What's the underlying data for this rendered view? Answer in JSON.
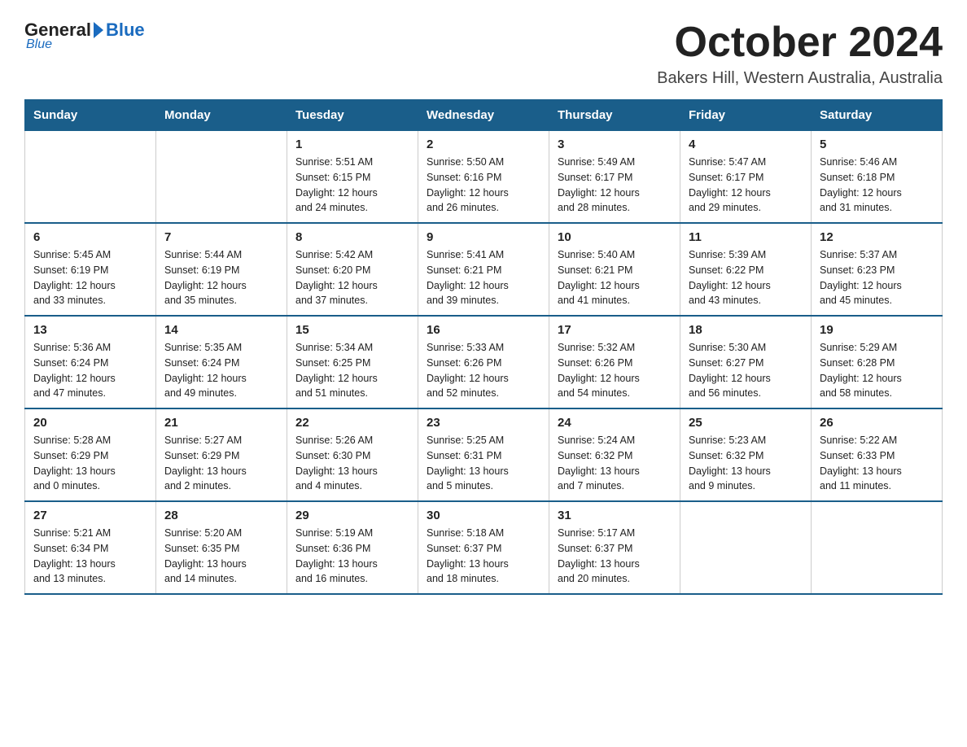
{
  "logo": {
    "text_general": "General",
    "text_blue": "Blue",
    "underline": "Blue"
  },
  "header": {
    "month": "October 2024",
    "location": "Bakers Hill, Western Australia, Australia"
  },
  "days_of_week": [
    "Sunday",
    "Monday",
    "Tuesday",
    "Wednesday",
    "Thursday",
    "Friday",
    "Saturday"
  ],
  "weeks": [
    [
      {
        "day": "",
        "info": ""
      },
      {
        "day": "",
        "info": ""
      },
      {
        "day": "1",
        "info": "Sunrise: 5:51 AM\nSunset: 6:15 PM\nDaylight: 12 hours\nand 24 minutes."
      },
      {
        "day": "2",
        "info": "Sunrise: 5:50 AM\nSunset: 6:16 PM\nDaylight: 12 hours\nand 26 minutes."
      },
      {
        "day": "3",
        "info": "Sunrise: 5:49 AM\nSunset: 6:17 PM\nDaylight: 12 hours\nand 28 minutes."
      },
      {
        "day": "4",
        "info": "Sunrise: 5:47 AM\nSunset: 6:17 PM\nDaylight: 12 hours\nand 29 minutes."
      },
      {
        "day": "5",
        "info": "Sunrise: 5:46 AM\nSunset: 6:18 PM\nDaylight: 12 hours\nand 31 minutes."
      }
    ],
    [
      {
        "day": "6",
        "info": "Sunrise: 5:45 AM\nSunset: 6:19 PM\nDaylight: 12 hours\nand 33 minutes."
      },
      {
        "day": "7",
        "info": "Sunrise: 5:44 AM\nSunset: 6:19 PM\nDaylight: 12 hours\nand 35 minutes."
      },
      {
        "day": "8",
        "info": "Sunrise: 5:42 AM\nSunset: 6:20 PM\nDaylight: 12 hours\nand 37 minutes."
      },
      {
        "day": "9",
        "info": "Sunrise: 5:41 AM\nSunset: 6:21 PM\nDaylight: 12 hours\nand 39 minutes."
      },
      {
        "day": "10",
        "info": "Sunrise: 5:40 AM\nSunset: 6:21 PM\nDaylight: 12 hours\nand 41 minutes."
      },
      {
        "day": "11",
        "info": "Sunrise: 5:39 AM\nSunset: 6:22 PM\nDaylight: 12 hours\nand 43 minutes."
      },
      {
        "day": "12",
        "info": "Sunrise: 5:37 AM\nSunset: 6:23 PM\nDaylight: 12 hours\nand 45 minutes."
      }
    ],
    [
      {
        "day": "13",
        "info": "Sunrise: 5:36 AM\nSunset: 6:24 PM\nDaylight: 12 hours\nand 47 minutes."
      },
      {
        "day": "14",
        "info": "Sunrise: 5:35 AM\nSunset: 6:24 PM\nDaylight: 12 hours\nand 49 minutes."
      },
      {
        "day": "15",
        "info": "Sunrise: 5:34 AM\nSunset: 6:25 PM\nDaylight: 12 hours\nand 51 minutes."
      },
      {
        "day": "16",
        "info": "Sunrise: 5:33 AM\nSunset: 6:26 PM\nDaylight: 12 hours\nand 52 minutes."
      },
      {
        "day": "17",
        "info": "Sunrise: 5:32 AM\nSunset: 6:26 PM\nDaylight: 12 hours\nand 54 minutes."
      },
      {
        "day": "18",
        "info": "Sunrise: 5:30 AM\nSunset: 6:27 PM\nDaylight: 12 hours\nand 56 minutes."
      },
      {
        "day": "19",
        "info": "Sunrise: 5:29 AM\nSunset: 6:28 PM\nDaylight: 12 hours\nand 58 minutes."
      }
    ],
    [
      {
        "day": "20",
        "info": "Sunrise: 5:28 AM\nSunset: 6:29 PM\nDaylight: 13 hours\nand 0 minutes."
      },
      {
        "day": "21",
        "info": "Sunrise: 5:27 AM\nSunset: 6:29 PM\nDaylight: 13 hours\nand 2 minutes."
      },
      {
        "day": "22",
        "info": "Sunrise: 5:26 AM\nSunset: 6:30 PM\nDaylight: 13 hours\nand 4 minutes."
      },
      {
        "day": "23",
        "info": "Sunrise: 5:25 AM\nSunset: 6:31 PM\nDaylight: 13 hours\nand 5 minutes."
      },
      {
        "day": "24",
        "info": "Sunrise: 5:24 AM\nSunset: 6:32 PM\nDaylight: 13 hours\nand 7 minutes."
      },
      {
        "day": "25",
        "info": "Sunrise: 5:23 AM\nSunset: 6:32 PM\nDaylight: 13 hours\nand 9 minutes."
      },
      {
        "day": "26",
        "info": "Sunrise: 5:22 AM\nSunset: 6:33 PM\nDaylight: 13 hours\nand 11 minutes."
      }
    ],
    [
      {
        "day": "27",
        "info": "Sunrise: 5:21 AM\nSunset: 6:34 PM\nDaylight: 13 hours\nand 13 minutes."
      },
      {
        "day": "28",
        "info": "Sunrise: 5:20 AM\nSunset: 6:35 PM\nDaylight: 13 hours\nand 14 minutes."
      },
      {
        "day": "29",
        "info": "Sunrise: 5:19 AM\nSunset: 6:36 PM\nDaylight: 13 hours\nand 16 minutes."
      },
      {
        "day": "30",
        "info": "Sunrise: 5:18 AM\nSunset: 6:37 PM\nDaylight: 13 hours\nand 18 minutes."
      },
      {
        "day": "31",
        "info": "Sunrise: 5:17 AM\nSunset: 6:37 PM\nDaylight: 13 hours\nand 20 minutes."
      },
      {
        "day": "",
        "info": ""
      },
      {
        "day": "",
        "info": ""
      }
    ]
  ]
}
